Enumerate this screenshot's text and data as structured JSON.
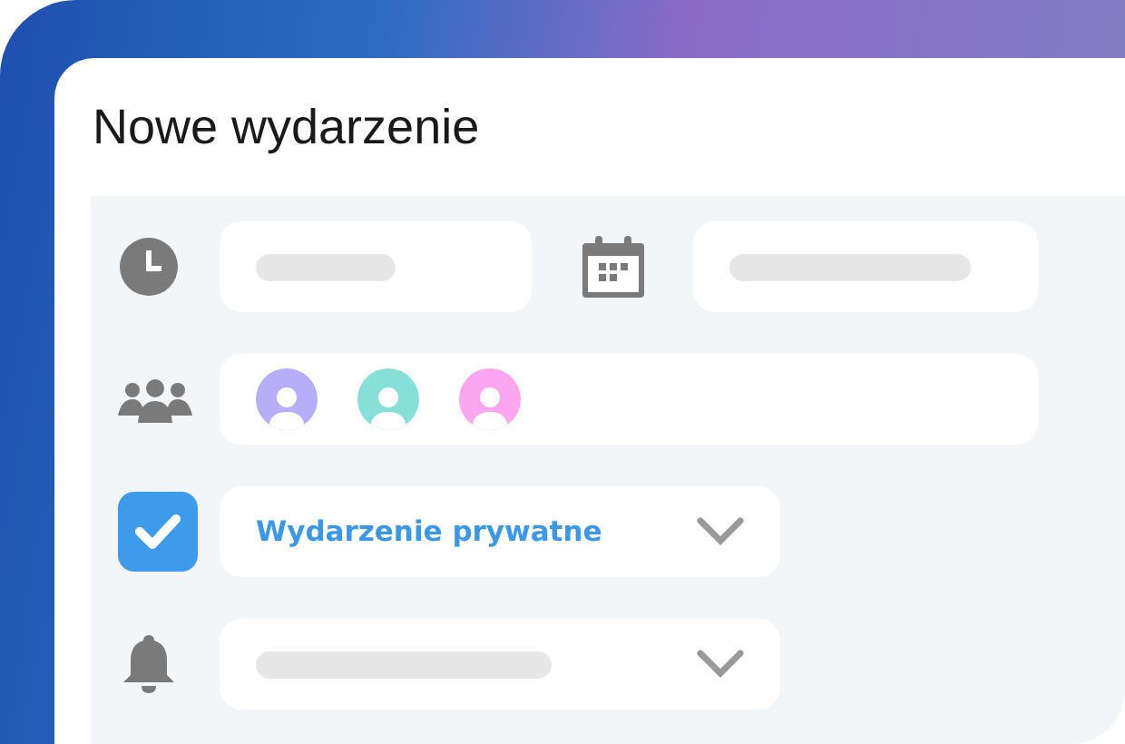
{
  "dialog": {
    "title": "Nowe wydarzenie"
  },
  "attendees": [
    {
      "color": "#b6aef8"
    },
    {
      "color": "#86e0d8"
    },
    {
      "color": "#fca5f1"
    }
  ],
  "private_event": {
    "checked": true,
    "label": "Wydarzenie prywatne"
  }
}
